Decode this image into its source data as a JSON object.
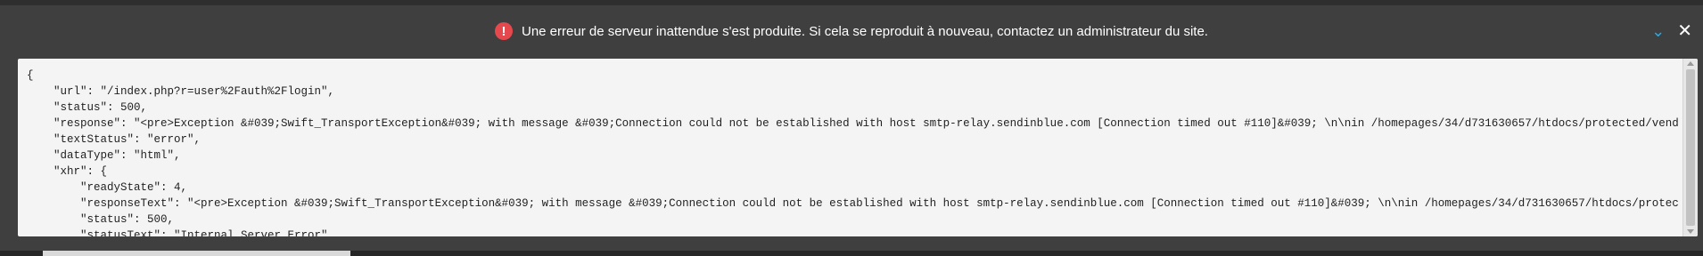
{
  "banner": {
    "icon": "exclamation-circle-icon",
    "icon_glyph": "!",
    "message": "Une erreur de serveur inattendue s'est produite. Si cela se reproduit à nouveau, contactez un administrateur du site.",
    "collapse_glyph": "⌄",
    "close_glyph": "✕",
    "error_color": "#e5484d",
    "accent_color": "#2aa9e0"
  },
  "code_lines": [
    "{",
    "    \"url\": \"/index.php?r=user%2Fauth%2Flogin\",",
    "    \"status\": 500,",
    "    \"response\": \"<pre>Exception &#039;Swift_TransportException&#039; with message &#039;Connection could not be established with host smtp-relay.sendinblue.com [Connection timed out #110]&#039; \\n\\nin /homepages/34/d731630657/htdocs/protected/vendor/swiftmail",
    "    \"textStatus\": \"error\",",
    "    \"dataType\": \"html\",",
    "    \"xhr\": {",
    "        \"readyState\": 4,",
    "        \"responseText\": \"<pre>Exception &#039;Swift_TransportException&#039; with message &#039;Connection could not be established with host smtp-relay.sendinblue.com [Connection timed out #110]&#039; \\n\\nin /homepages/34/d731630657/htdocs/protected/vendor/s",
    "        \"status\": 500,",
    "        \"statusText\": \"Internal Server Error\","
  ]
}
